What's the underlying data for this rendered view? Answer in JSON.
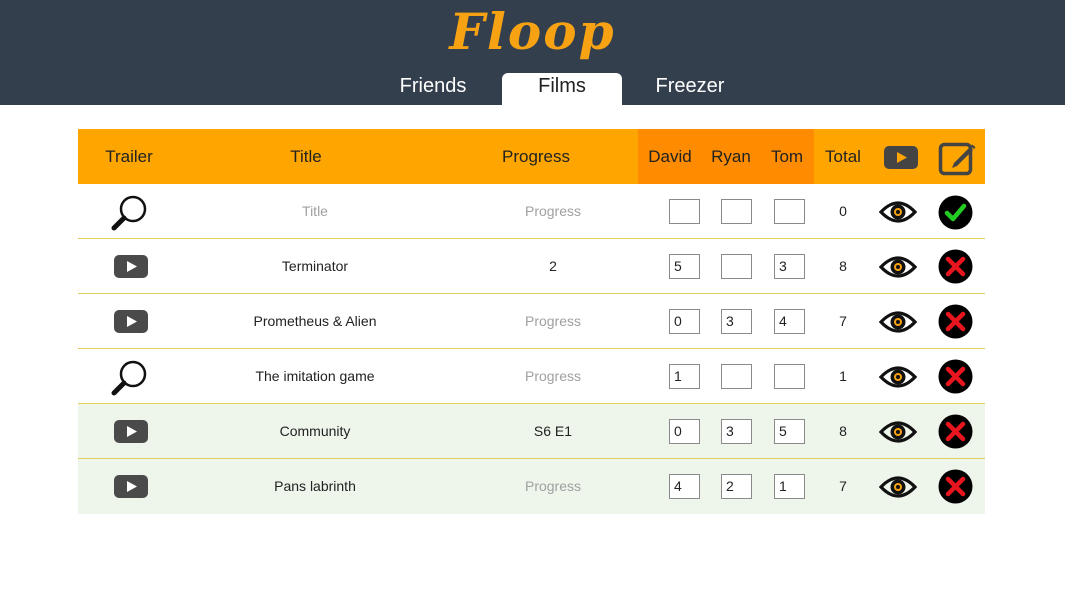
{
  "app": {
    "logo": "Floop",
    "tabs": [
      {
        "label": "Friends",
        "active": false
      },
      {
        "label": "Films",
        "active": true
      },
      {
        "label": "Freezer",
        "active": false
      }
    ]
  },
  "colors": {
    "header_bg": "#333f4d",
    "accent": "#ffa500",
    "accent_dark": "#ff8c00",
    "logo": "#f7a212",
    "row_alt": "#eef6ec",
    "confirm_green": "#22cc22",
    "delete_red": "#e8141e"
  },
  "table": {
    "headers": {
      "trailer": "Trailer",
      "title": "Title",
      "progress": "Progress",
      "david": "David",
      "ryan": "Ryan",
      "tom": "Tom",
      "total": "Total",
      "youtube_icon": "youtube-icon",
      "edit_icon": "edit-icon"
    },
    "new_row": {
      "trailer_icon": "search-icon",
      "title_placeholder": "Title",
      "progress_placeholder": "Progress",
      "david": "",
      "ryan": "",
      "tom": "",
      "total": "0",
      "watch_icon": "eye-icon",
      "action_icon": "confirm-icon"
    },
    "rows": [
      {
        "trailer_icon": "youtube-play-icon",
        "title": "Terminator",
        "progress": "2",
        "progress_placeholder": "Progress",
        "david": "5",
        "ryan": "",
        "tom": "3",
        "total": "8",
        "watch_icon": "eye-icon",
        "action_icon": "delete-icon",
        "highlight": false
      },
      {
        "trailer_icon": "youtube-play-icon",
        "title": "Prometheus & Alien",
        "progress": "",
        "progress_placeholder": "Progress",
        "david": "0",
        "ryan": "3",
        "tom": "4",
        "total": "7",
        "watch_icon": "eye-icon",
        "action_icon": "delete-icon",
        "highlight": false
      },
      {
        "trailer_icon": "search-icon",
        "title": "The imitation game",
        "progress": "",
        "progress_placeholder": "Progress",
        "david": "1",
        "ryan": "",
        "tom": "",
        "total": "1",
        "watch_icon": "eye-icon",
        "action_icon": "delete-icon",
        "highlight": false
      },
      {
        "trailer_icon": "youtube-play-icon",
        "title": "Community",
        "progress": "S6 E1",
        "progress_placeholder": "Progress",
        "david": "0",
        "ryan": "3",
        "tom": "5",
        "total": "8",
        "watch_icon": "eye-icon",
        "action_icon": "delete-icon",
        "highlight": true
      },
      {
        "trailer_icon": "youtube-play-icon",
        "title": "Pans labrinth",
        "progress": "",
        "progress_placeholder": "Progress",
        "david": "4",
        "ryan": "2",
        "tom": "1",
        "total": "7",
        "watch_icon": "eye-icon",
        "action_icon": "delete-icon",
        "highlight": true
      }
    ]
  }
}
